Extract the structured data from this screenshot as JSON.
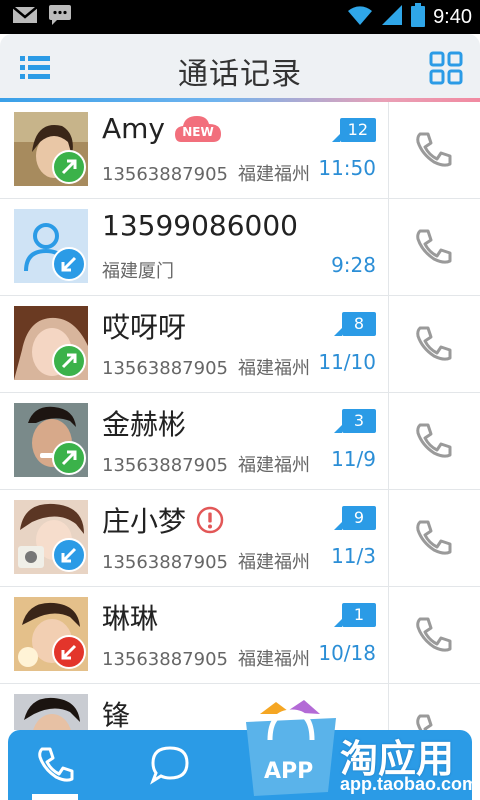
{
  "status_bar": {
    "time": "9:40"
  },
  "header": {
    "title": "通话记录"
  },
  "rows": [
    {
      "name": "Amy",
      "tag": "NEW",
      "phone": "13563887905",
      "location": "福建福州",
      "count": "12",
      "time": "11:50",
      "direction": "outgoing"
    },
    {
      "name": "13599086000",
      "phone": "",
      "location": "福建厦门",
      "count": "",
      "time": "9:28",
      "direction": "incoming"
    },
    {
      "name": "哎呀呀",
      "phone": "13563887905",
      "location": "福建福州",
      "count": "8",
      "time": "11/10",
      "direction": "outgoing"
    },
    {
      "name": "金赫彬",
      "phone": "13563887905",
      "location": "福建福州",
      "count": "3",
      "time": "11/9",
      "direction": "outgoing"
    },
    {
      "name": "庄小梦",
      "phone": "13563887905",
      "location": "福建福州",
      "count": "9",
      "time": "11/3",
      "direction": "incoming",
      "alert": true
    },
    {
      "name": "琳琳",
      "phone": "13563887905",
      "location": "福建福州",
      "count": "1",
      "time": "10/18",
      "direction": "missed"
    },
    {
      "name": "锋",
      "phone": "",
      "location": "",
      "count": "",
      "time": "",
      "direction": ""
    }
  ],
  "watermark": {
    "brand": "淘应用",
    "url": "app.taobao.com"
  },
  "colors": {
    "accent": "#2b9be6",
    "outgoing": "#3bb24a",
    "missed": "#e3352b"
  }
}
